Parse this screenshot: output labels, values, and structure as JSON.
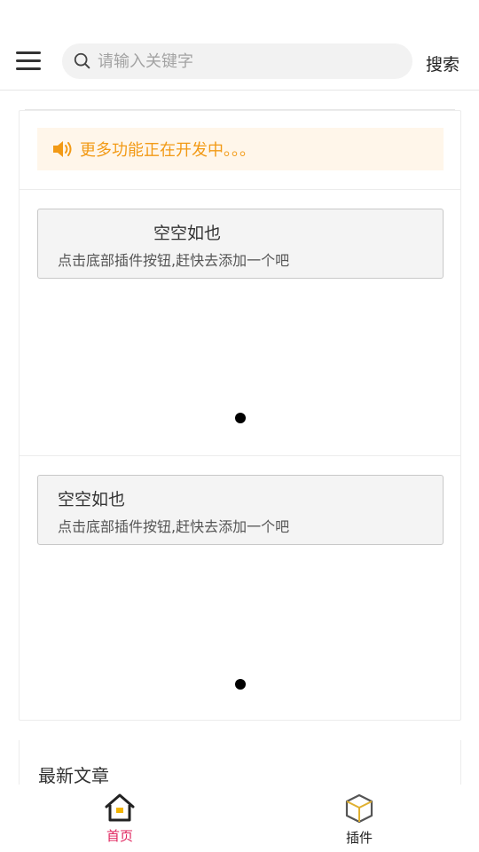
{
  "header": {
    "search": {
      "placeholder": "请输入关键字",
      "value": ""
    },
    "search_button_label": "搜索"
  },
  "notice": {
    "text": "更多功能正在开发中。。。",
    "color": "#f29a16"
  },
  "plugin_sections": [
    {
      "title": "空空如也",
      "subtitle": "点击底部插件按钮,赶快去添加一个吧"
    },
    {
      "title": "空空如也",
      "subtitle": "点击底部插件按钮,赶快去添加一个吧"
    }
  ],
  "latest": {
    "title": "最新文章"
  },
  "tabbar": {
    "items": [
      {
        "label": "首页",
        "icon": "home-icon",
        "active": true,
        "color": "#e0245e"
      },
      {
        "label": "插件",
        "icon": "cube-icon",
        "active": false,
        "color": "#222222"
      }
    ]
  }
}
